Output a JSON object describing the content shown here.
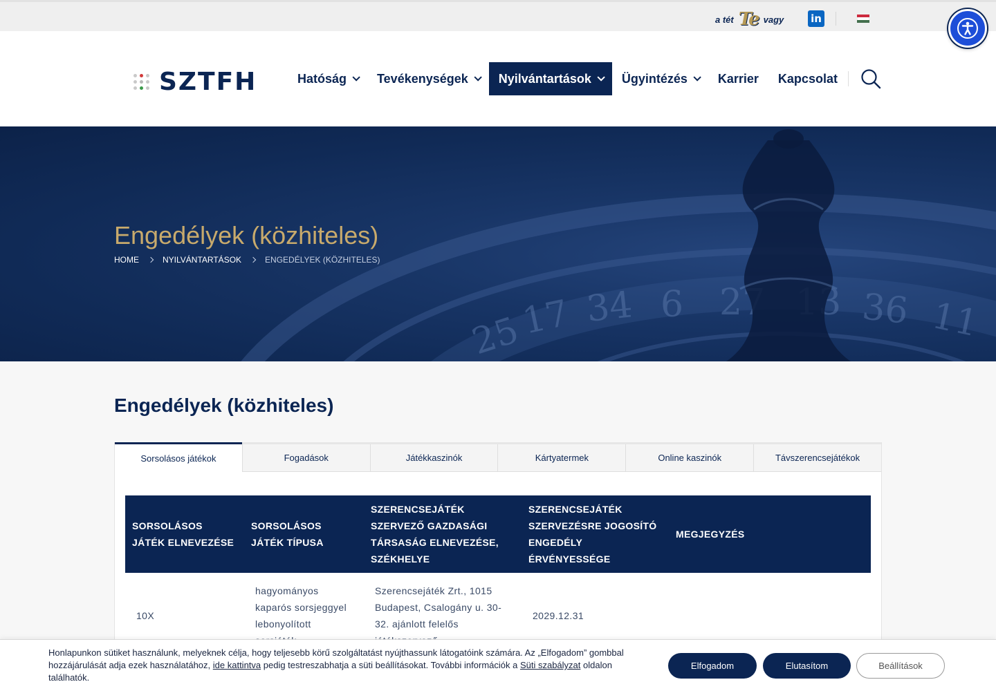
{
  "topbar": {
    "slogan_pre": "a tét",
    "slogan_te": "Te",
    "slogan_post": "vagy",
    "linkedin_label": "in",
    "flag_colors": [
      "#cd2a3e",
      "#ffffff",
      "#436f4d"
    ]
  },
  "header": {
    "logo_text": "SZTFH",
    "nav": [
      {
        "label": "Hatóság",
        "dropdown": true
      },
      {
        "label": "Tevékenységek",
        "dropdown": true
      },
      {
        "label": "Nyilvántartások",
        "dropdown": true,
        "active": true
      },
      {
        "label": "Ügyintézés",
        "dropdown": true
      },
      {
        "label": "Karrier",
        "dropdown": false
      },
      {
        "label": "Kapcsolat",
        "dropdown": false
      }
    ]
  },
  "hero": {
    "title": "Engedélyek (közhiteles)",
    "breadcrumb": [
      "HOME",
      "NYILVÁNTARTÁSOK",
      "ENGEDÉLYEK (KÖZHITELES)"
    ]
  },
  "main": {
    "title": "Engedélyek (közhiteles)",
    "tabs": [
      "Sorsolásos játékok",
      "Fogadások",
      "Játékkaszinók",
      "Kártyatermek",
      "Online kaszinók",
      "Távszerencsejátékok"
    ],
    "active_tab": 0,
    "table": {
      "headers": [
        "Sorsolásos játék elnevezése",
        "Sorsolásos játék típusa",
        "Szerencsejáték szervező gazdasági társaság elnevezése, székhelye",
        "Szerencsejáték szervezésre jogosító engedély érvényessége",
        "Megjegyzés"
      ],
      "rows": [
        [
          "10X",
          "hagyományos kaparós sorsjeggyel lebonyolított sorsjáték",
          "Szerencsejáték Zrt., 1015 Budapest, Csalogány u. 30-32. ajánlott felelős játékszervező",
          "2029.12.31",
          ""
        ]
      ]
    }
  },
  "cookie": {
    "text_1": "Honlapunkon sütiket használunk, melyeknek célja, hogy teljesebb körű szolgáltatást nyújthassunk látogatóink számára. Az „Elfogadom” gombbal hozzájárulását adja ezek használatához, ",
    "link_1": "ide kattintva",
    "text_2": " pedig testreszabhatja a süti beállításokat. További információk a ",
    "link_2": "Süti szabályzat",
    "text_3": " oldalon találhatók.",
    "accept": "Elfogadom",
    "reject": "Elutasítom",
    "settings": "Beállítások"
  },
  "colors": {
    "navy": "#0b2553",
    "gold": "#c8aa6c",
    "accessibility_blue": "#1d4ed8"
  }
}
